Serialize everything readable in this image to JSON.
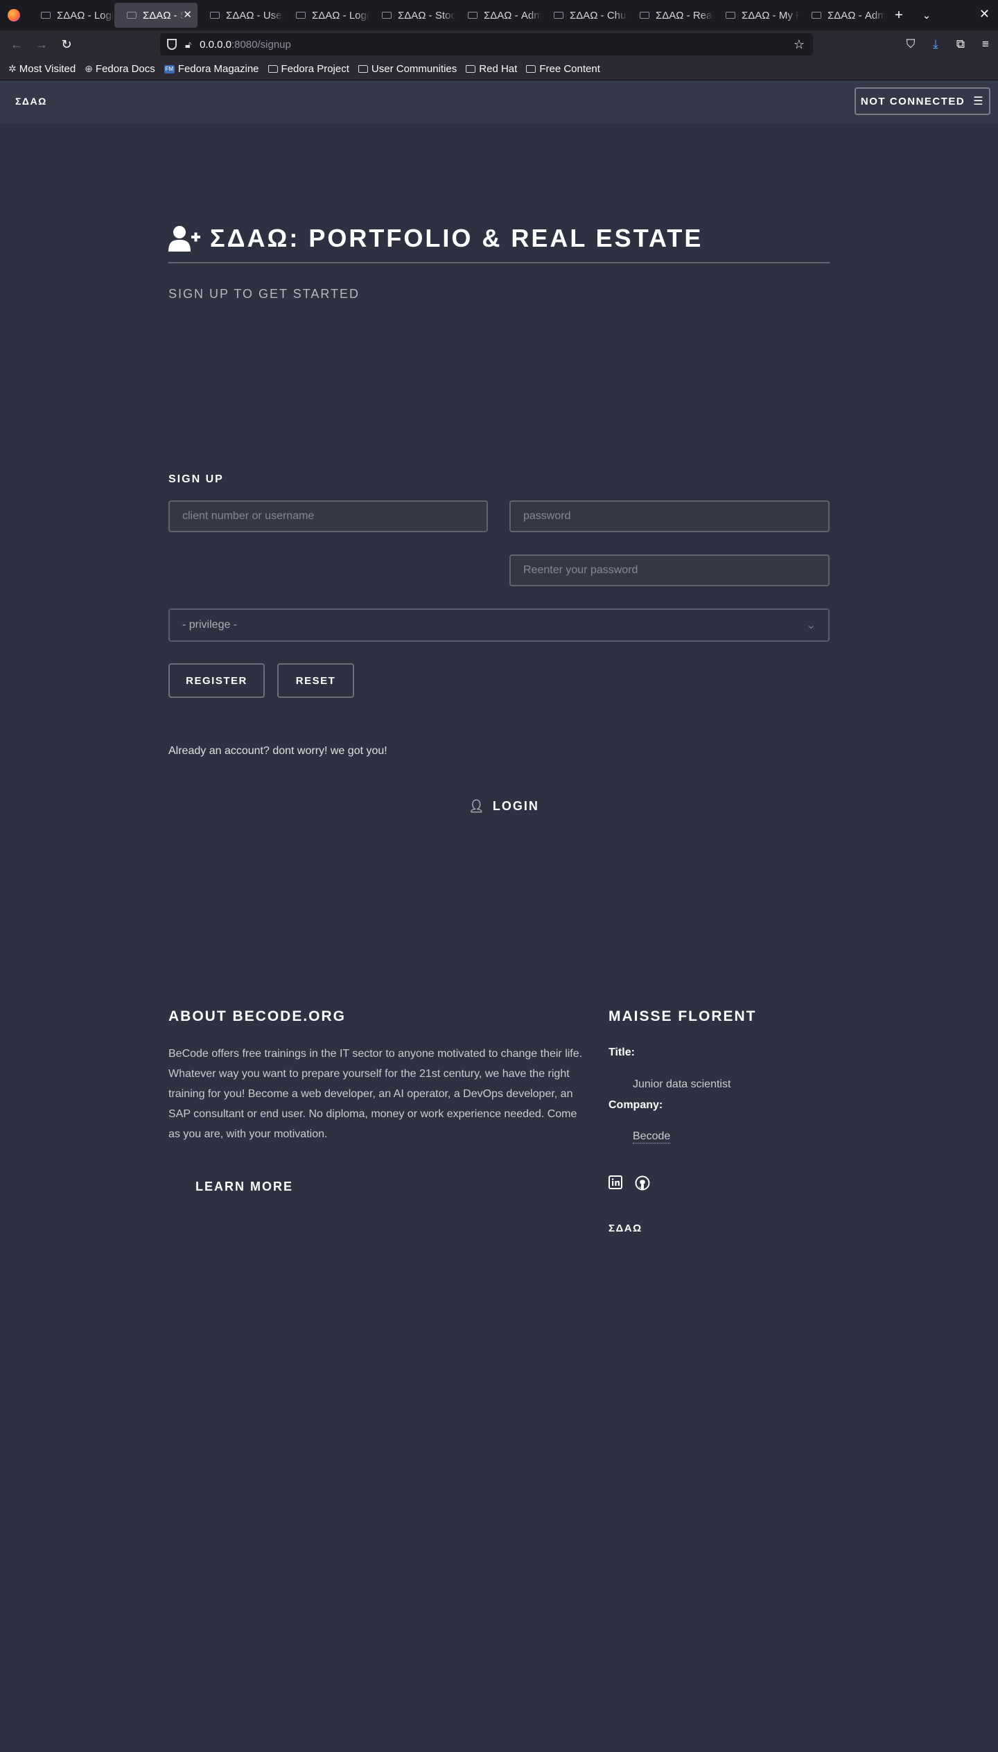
{
  "browser": {
    "tabs": [
      {
        "title": "ΣΔΑΩ - Login",
        "active": false
      },
      {
        "title": "ΣΔΑΩ - Sign up",
        "active": true
      },
      {
        "title": "ΣΔΑΩ - Users",
        "active": false
      },
      {
        "title": "ΣΔΑΩ - Logout",
        "active": false
      },
      {
        "title": "ΣΔΑΩ - Stock",
        "active": false
      },
      {
        "title": "ΣΔΑΩ - Admin",
        "active": false
      },
      {
        "title": "ΣΔΑΩ - Churn",
        "active": false
      },
      {
        "title": "ΣΔΑΩ - Real estate",
        "active": false
      },
      {
        "title": "ΣΔΑΩ - My P",
        "active": false
      },
      {
        "title": "ΣΔΑΩ - Admin",
        "active": false
      }
    ],
    "url_host": "0.0.0.0",
    "url_rest": ":8080/signup",
    "bookmarks": [
      "Most Visited",
      "Fedora Docs",
      "Fedora Magazine",
      "Fedora Project",
      "User Communities",
      "Red Hat",
      "Free Content"
    ]
  },
  "header": {
    "brand": "ΣΔΑΩ",
    "menu_label": "NOT CONNECTED"
  },
  "banner": {
    "title": "ΣΔΑΩ: PORTFOLIO & REAL ESTATE",
    "subtitle": "SIGN UP TO GET STARTED"
  },
  "form": {
    "heading": "SIGN UP",
    "username_placeholder": "client number or username",
    "password_placeholder": "password",
    "repassword_placeholder": "Reenter your password",
    "privilege_selected": "- privilege -",
    "register_label": "REGISTER",
    "reset_label": "RESET"
  },
  "login": {
    "prompt": "Already an account? dont worry! we got you!",
    "label": "LOGIN"
  },
  "footer": {
    "about_title": "ABOUT BECODE.ORG",
    "about_text": "BeCode offers free trainings in the IT sector to anyone motivated to change their life. Whatever way you want to prepare yourself for the 21st century, we have the right training for you! Become a web developer, an AI operator, a DevOps developer, an SAP consultant or end user. No diploma, money or work experience needed. Come as you are, with your motivation.",
    "learn_more": "LEARN MORE",
    "contact_title": "MAISSE FLORENT",
    "title_label": "Title:",
    "title_value": "Junior data scientist",
    "company_label": "Company:",
    "company_value": "Becode",
    "brand": "ΣΔΑΩ"
  },
  "colors": {
    "page_bg": "#2e3141",
    "header_bg": "#353849",
    "chrome_bg": "#2b2a33",
    "tabbar_bg": "#1c1b22"
  }
}
